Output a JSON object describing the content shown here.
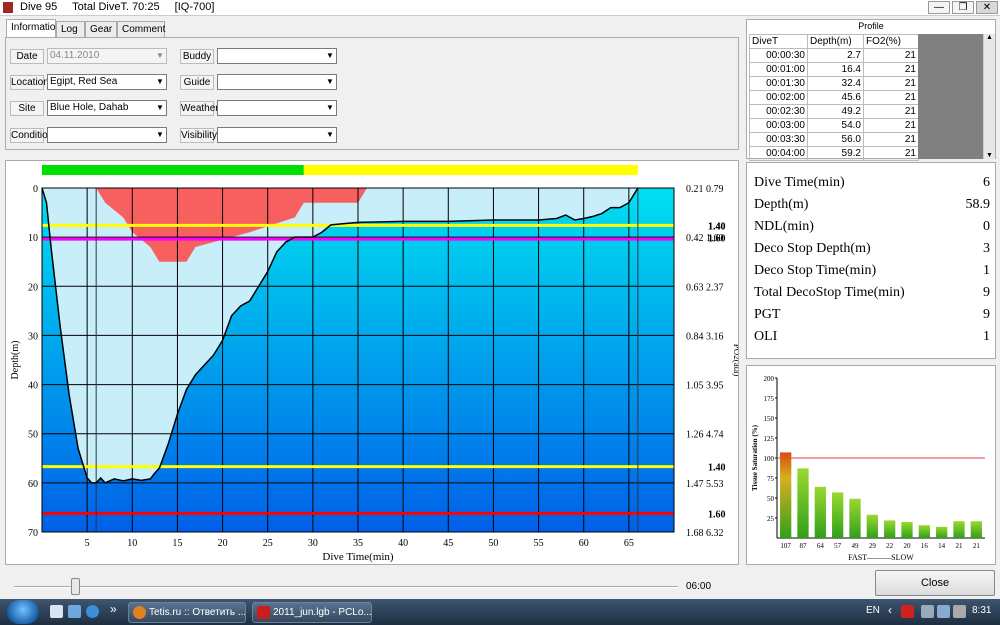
{
  "window": {
    "title_dive": "Dive 95",
    "title_total": "Total DiveT. 70:25",
    "title_device": "[IQ-700]",
    "btn_minimize": "—",
    "btn_restore": "❐",
    "btn_close": "✕"
  },
  "tabs": [
    "Information",
    "Log",
    "Gear",
    "Comment"
  ],
  "form": {
    "date_label": "Date",
    "date_value": "04.11.2010",
    "location_label": "Location",
    "location_value": "Egipt, Red Sea",
    "site_label": "Site",
    "site_value": "Blue Hole, Dahab",
    "condition_label": "Condition",
    "condition_value": "",
    "buddy_label": "Buddy",
    "buddy_value": "",
    "guide_label": "Guide",
    "guide_value": "",
    "weather_label": "Weather",
    "weather_value": "",
    "visibility_label": "Visibility",
    "visibility_value": "",
    "dropdown_glyph": "▼"
  },
  "profile": {
    "title": "Profile",
    "headers": [
      "DiveT",
      "Depth(m)",
      "FO2(%)"
    ],
    "rows": [
      [
        "00:00:30",
        "2.7",
        "21"
      ],
      [
        "00:01:00",
        "16.4",
        "21"
      ],
      [
        "00:01:30",
        "32.4",
        "21"
      ],
      [
        "00:02:00",
        "45.6",
        "21"
      ],
      [
        "00:02:30",
        "49.2",
        "21"
      ],
      [
        "00:03:00",
        "54.0",
        "21"
      ],
      [
        "00:03:30",
        "56.0",
        "21"
      ],
      [
        "00:04:00",
        "59.2",
        "21"
      ]
    ],
    "scroll_up": "▲",
    "scroll_down": "▼"
  },
  "stats": [
    {
      "label": "Dive Time(min)",
      "value": "6"
    },
    {
      "label": "Depth(m)",
      "value": "58.9"
    },
    {
      "label": "NDL(min)",
      "value": "0"
    },
    {
      "label": "Deco Stop Depth(m)",
      "value": "3"
    },
    {
      "label": "Deco Stop Time(min)",
      "value": "1"
    },
    {
      "label": "Total DecoStop Time(min)",
      "value": "9"
    },
    {
      "label": "PGT",
      "value": "9"
    },
    {
      "label": "OLI",
      "value": "1"
    }
  ],
  "chart_data": [
    {
      "type": "area",
      "xlabel": "Dive Time(min)",
      "ylabel": "Depth(m)",
      "y2label": "PO2(ata)",
      "x_ticks": [
        5,
        10,
        15,
        20,
        25,
        30,
        35,
        40,
        45,
        50,
        55,
        60,
        65
      ],
      "y_ticks": [
        0,
        10,
        20,
        30,
        40,
        50,
        60,
        70
      ],
      "xlim": [
        0,
        70
      ],
      "ylim": [
        0,
        70
      ],
      "right_ticks": [
        {
          "depth": 0,
          "a": "0.21",
          "b": "0.79"
        },
        {
          "depth": 10,
          "a": "0.42",
          "b": "1.60"
        },
        {
          "depth": 20,
          "a": "0.63",
          "b": "2.37"
        },
        {
          "depth": 30,
          "a": "0.84",
          "b": "3.16"
        },
        {
          "depth": 40,
          "a": "1.05",
          "b": "3.95"
        },
        {
          "depth": 50,
          "a": "1.26",
          "b": "4.74"
        },
        {
          "depth": 60,
          "a": "1.47",
          "b": "5.53"
        },
        {
          "depth": 70,
          "a": "1.68",
          "b": "6.32"
        }
      ],
      "ref_lines": [
        {
          "depth": 7.6,
          "color": "#ffff00",
          "label": "1.40"
        },
        {
          "depth": 10.4,
          "color": "#ff00ff",
          "label": ""
        },
        {
          "depth": 56.7,
          "color": "#ffff00",
          "label": "1.40"
        },
        {
          "depth": 66.2,
          "color": "#ff0000",
          "label": "1.60"
        }
      ],
      "ref_labels_upper": [
        "1.40",
        "1.60"
      ],
      "marker_x": [
        6,
        66
      ],
      "depth_profile": {
        "x": [
          0,
          0.5,
          1,
          2,
          3,
          4,
          5,
          5.5,
          6,
          6.5,
          7,
          8,
          9,
          10,
          11,
          12,
          12.5,
          13,
          14,
          15,
          16,
          17,
          18,
          19,
          20,
          21,
          22,
          23,
          24,
          25,
          26,
          27,
          28,
          29,
          30,
          31,
          32,
          35,
          40,
          45,
          50,
          55,
          57,
          58,
          59,
          60,
          61,
          62,
          63,
          64,
          65,
          66
        ],
        "y": [
          0,
          3,
          12,
          28,
          42,
          53,
          59,
          60,
          60,
          59,
          60,
          59.2,
          59.6,
          59.2,
          59.5,
          59.2,
          58,
          57,
          52,
          46,
          41,
          38,
          36,
          34,
          31,
          26,
          24,
          23,
          20,
          17,
          13,
          11,
          10,
          10,
          10,
          9,
          7.5,
          7,
          6.8,
          6.8,
          6.5,
          6.5,
          6.2,
          5.5,
          6.5,
          6.2,
          5.8,
          5.2,
          4,
          4,
          3,
          0
        ]
      },
      "deco_ceiling": {
        "x": [
          6,
          7,
          9,
          10,
          12,
          13,
          16,
          17,
          23,
          28,
          29,
          33,
          35,
          36,
          46
        ],
        "y": [
          0,
          3,
          6,
          9,
          12,
          15,
          15,
          12,
          9,
          6,
          3,
          3,
          3,
          0,
          0
        ]
      },
      "status_bar": [
        {
          "to": 29,
          "color": "#00e000"
        },
        {
          "to": 66,
          "color": "#ffff00"
        }
      ]
    },
    {
      "type": "bar",
      "ylabel": "Tissue Saturation (%)",
      "xlabel": "FAST———SLOW",
      "categories": [
        "107",
        "87",
        "64",
        "57",
        "49",
        "29",
        "22",
        "20",
        "16",
        "14",
        "21",
        "21"
      ],
      "values": [
        107,
        87,
        64,
        57,
        49,
        29,
        22,
        20,
        16,
        14,
        21,
        21
      ],
      "y_ticks": [
        25,
        50,
        75,
        100,
        125,
        150,
        175,
        200
      ],
      "ylim": [
        0,
        200
      ],
      "ref_line": 100
    }
  ],
  "slider": {
    "time": "06:00"
  },
  "close_button": "Close",
  "taskbar": {
    "btn1": "Tetis.ru :: Ответить ...",
    "btn2": "2011_jun.lgb - PCLo...",
    "lang": "EN",
    "clock": "8:31",
    "show_more": "»",
    "tray_arrow": "‹"
  }
}
